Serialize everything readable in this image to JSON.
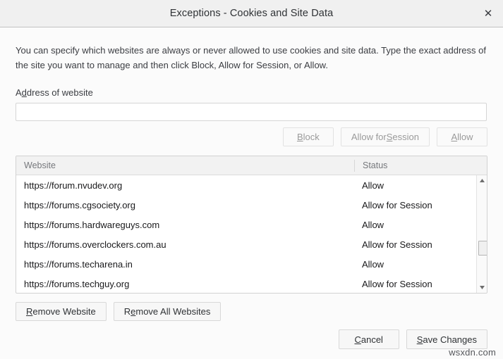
{
  "titlebar": {
    "title": "Exceptions - Cookies and Site Data",
    "close_icon": "close-icon",
    "close_glyph": "✕"
  },
  "main": {
    "description": "You can specify which websites are always or never allowed to use cookies and site data. Type the exact address of the site you want to manage and then click Block, Allow for Session, or Allow.",
    "address_label_pre": "A",
    "address_label_key": "d",
    "address_label_post": "dress of website",
    "address_value": "",
    "address_placeholder": ""
  },
  "action_buttons": [
    {
      "pre": "",
      "key": "B",
      "post": "lock",
      "disabled": true
    },
    {
      "pre": "Allow for ",
      "key": "S",
      "post": "ession",
      "disabled": true
    },
    {
      "pre": "",
      "key": "A",
      "post": "llow",
      "disabled": true
    }
  ],
  "list": {
    "columns": [
      "Website",
      "Status"
    ],
    "rows": [
      {
        "website": "https://forum.nvudev.org",
        "status": "Allow"
      },
      {
        "website": "https://forums.cgsociety.org",
        "status": "Allow for Session"
      },
      {
        "website": "https://forums.hardwareguys.com",
        "status": "Allow"
      },
      {
        "website": "https://forums.overclockers.com.au",
        "status": "Allow for Session"
      },
      {
        "website": "https://forums.techarena.in",
        "status": "Allow"
      },
      {
        "website": "https://forums.techguy.org",
        "status": "Allow for Session"
      }
    ],
    "scrollbar": {
      "up_icon": "scroll-up-arrow-icon",
      "down_icon": "scroll-down-arrow-icon"
    }
  },
  "remove_buttons": [
    {
      "pre": "",
      "key": "R",
      "post": "emove Website",
      "disabled": false
    },
    {
      "pre": "R",
      "key": "e",
      "post": "move All Websites",
      "disabled": false
    }
  ],
  "footer_buttons": [
    {
      "pre": "",
      "key": "C",
      "post": "ancel",
      "disabled": false
    },
    {
      "pre": "",
      "key": "S",
      "post": "ave Changes",
      "disabled": false
    }
  ],
  "watermark": "wsxdn.com"
}
